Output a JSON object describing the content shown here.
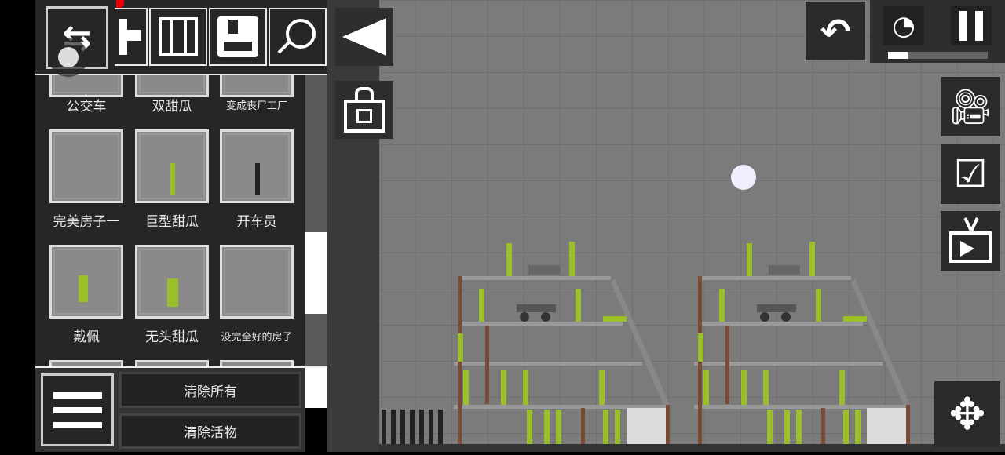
{
  "catalog": {
    "items": [
      {
        "label": "公交车"
      },
      {
        "label": "双甜瓜"
      },
      {
        "label": "变成丧尸工厂"
      },
      {
        "label": "完美房子一"
      },
      {
        "label": "巨型甜瓜"
      },
      {
        "label": "开车员"
      },
      {
        "label": "戴佩"
      },
      {
        "label": "无头甜瓜"
      },
      {
        "label": "没完全好的房子"
      }
    ]
  },
  "buttons": {
    "clear_all": "清除所有",
    "clear_living": "清除活物"
  },
  "time_scale": {
    "progress": 0.2
  },
  "colors": {
    "world": "#7b7b7b",
    "panel": "#262626",
    "melon": "#9bbf2a"
  }
}
